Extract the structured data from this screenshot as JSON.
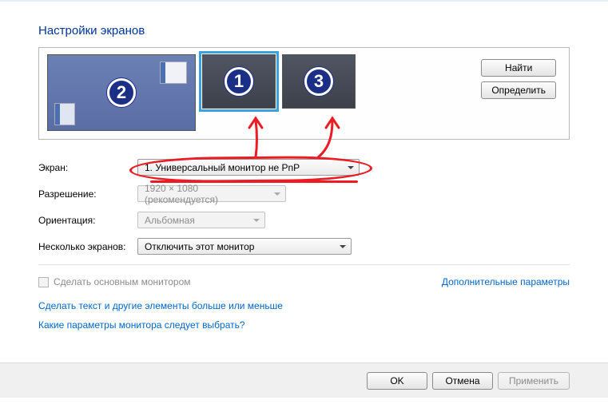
{
  "title": "Настройки экранов",
  "monitors": {
    "m1": "1",
    "m2": "2",
    "m3": "3"
  },
  "buttons": {
    "find": "Найти",
    "identify": "Определить",
    "ok": "OK",
    "cancel": "Отмена",
    "apply": "Применить"
  },
  "labels": {
    "screen": "Экран:",
    "resolution": "Разрешение:",
    "orientation": "Ориентация:",
    "multiple": "Несколько экранов:"
  },
  "values": {
    "screen": "1. Универсальный монитор не PnP",
    "resolution": "1920 × 1080 (рекомендуется)",
    "orientation": "Альбомная",
    "multiple": "Отключить этот монитор"
  },
  "checkbox": {
    "primary": "Сделать основным монитором"
  },
  "links": {
    "advanced": "Дополнительные параметры",
    "textsize": "Сделать текст и другие элементы больше или меньше",
    "which": "Какие параметры монитора следует выбрать?"
  }
}
